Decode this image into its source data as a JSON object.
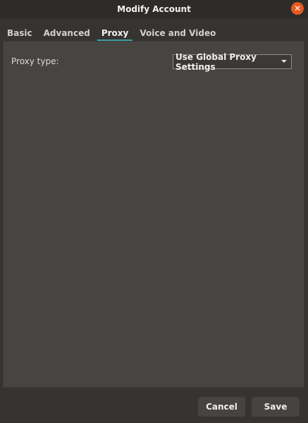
{
  "window": {
    "title": "Modify Account",
    "close_icon": "close-icon",
    "accent_color": "#3e9da0",
    "close_color": "#e5581f"
  },
  "tabs": [
    {
      "label": "Basic",
      "active": false
    },
    {
      "label": "Advanced",
      "active": false
    },
    {
      "label": "Proxy",
      "active": true
    },
    {
      "label": "Voice and Video",
      "active": false
    }
  ],
  "proxy": {
    "label": "Proxy type:",
    "selected": "Use Global Proxy Settings",
    "dropdown_icon": "chevron-down-icon"
  },
  "footer": {
    "cancel_label": "Cancel",
    "save_label": "Save"
  }
}
